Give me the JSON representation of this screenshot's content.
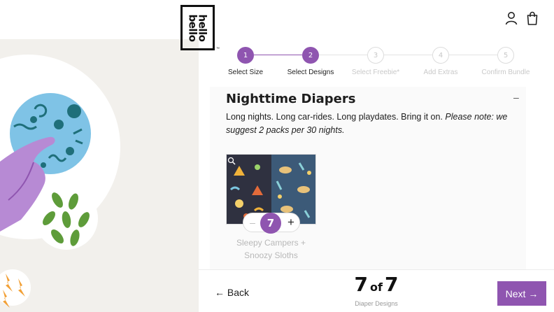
{
  "brand": {
    "logo_text": "hello bello",
    "trademark": "™"
  },
  "header": {
    "account_icon": "user-icon",
    "cart_icon": "shopping-bag-icon"
  },
  "stepper": {
    "accent": "#8f55b0",
    "steps": [
      {
        "number": "1",
        "label": "Select Size",
        "state": "complete"
      },
      {
        "number": "2",
        "label": "Select Designs",
        "state": "current"
      },
      {
        "number": "3",
        "label": "Select Freebie*",
        "state": "upcoming"
      },
      {
        "number": "4",
        "label": "Add Extras",
        "state": "upcoming"
      },
      {
        "number": "5",
        "label": "Confirm Bundle",
        "state": "upcoming"
      }
    ]
  },
  "section": {
    "title": "Nighttime Diapers",
    "collapse_symbol": "–",
    "description": "Long nights. Long car-rides. Long playdates. Bring it on.",
    "note": "Please note: we suggest 2 packs per 30 nights."
  },
  "product": {
    "name": "Sleepy Campers + Snoozy Sloths",
    "quantity": "7",
    "minus_symbol": "–",
    "plus_symbol": "+",
    "zoom_icon": "magnifier-icon"
  },
  "footer": {
    "back_label": "← Back",
    "selected": "7",
    "of_label": "of",
    "total": "7",
    "counter_caption": "Diaper Designs",
    "next_label": "Next →"
  }
}
